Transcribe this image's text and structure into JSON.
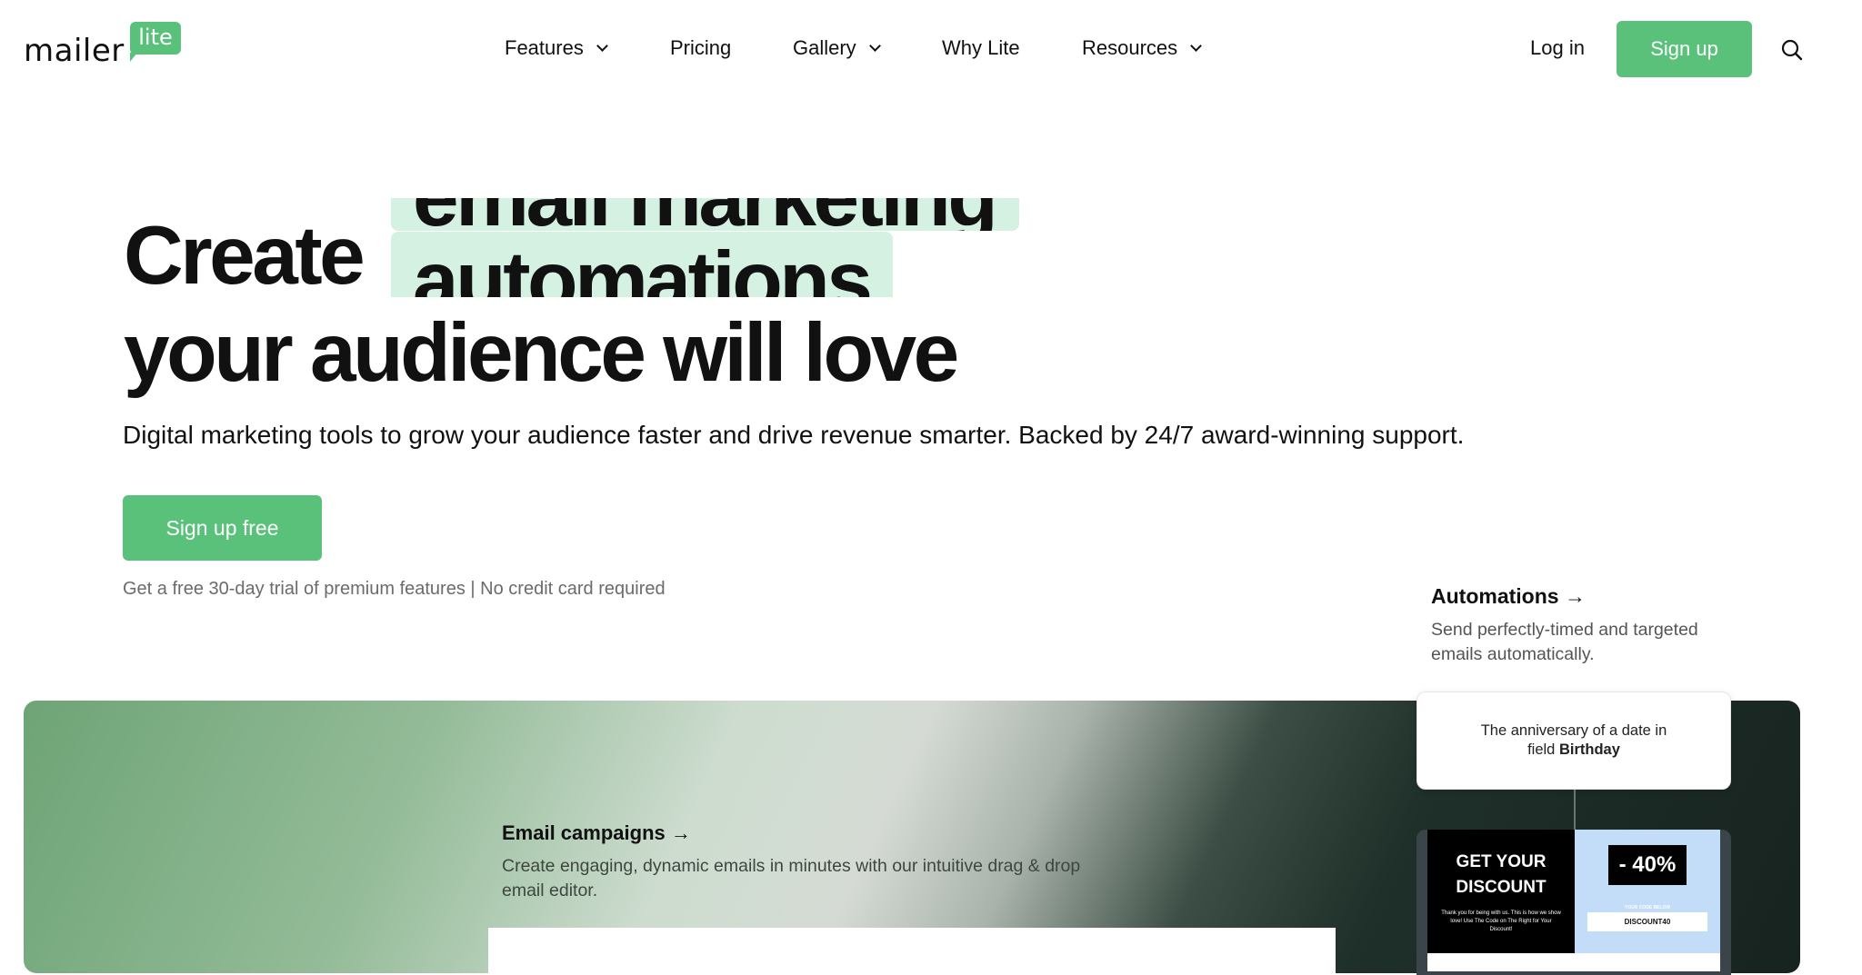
{
  "header": {
    "logo": {
      "main": "mailer",
      "badge": "lite"
    },
    "nav": [
      {
        "label": "Features",
        "has_dropdown": true
      },
      {
        "label": "Pricing",
        "has_dropdown": false
      },
      {
        "label": "Gallery",
        "has_dropdown": true
      },
      {
        "label": "Why Lite",
        "has_dropdown": false
      },
      {
        "label": "Resources",
        "has_dropdown": true
      }
    ],
    "login": "Log in",
    "signup": "Sign up",
    "search_icon": "search-icon"
  },
  "hero": {
    "title_start": "Create",
    "rotating_prev": "email marketing",
    "rotating_current": "automations",
    "title_end": "your audience will love",
    "subtitle": "Digital marketing tools to grow your audience faster and drive revenue smarter. Backed by 24/7 award-winning support.",
    "cta": "Sign up free",
    "note": "Get a free 30-day trial of premium features",
    "note_sep": "|",
    "note2": "No credit card required"
  },
  "features": {
    "automations": {
      "title": "Automations →",
      "desc_line1": "Send perfectly-timed and targeted",
      "desc_line2": "emails automatically."
    },
    "email_campaigns": {
      "title": "Email campaigns →",
      "desc_line1": "Create engaging, dynamic emails in minutes with our intuitive drag & drop",
      "desc_line2": "email editor."
    }
  },
  "automation_card": {
    "line1": "The anniversary of a date in",
    "line2_prefix": "field ",
    "line2_bold": "Birthday"
  },
  "discount_email": {
    "headline1": "GET YOUR",
    "headline2": "DISCOUNT",
    "body": "Thank you for being with us. This is how we show love! Use The Code on The Right for Your Discount!",
    "percent": "- 40%",
    "code_label": "YOUR CODE BELOW",
    "code": "DISCOUNT40"
  },
  "colors": {
    "brand": "#5ac17a",
    "highlight": "#d5f1e1"
  }
}
